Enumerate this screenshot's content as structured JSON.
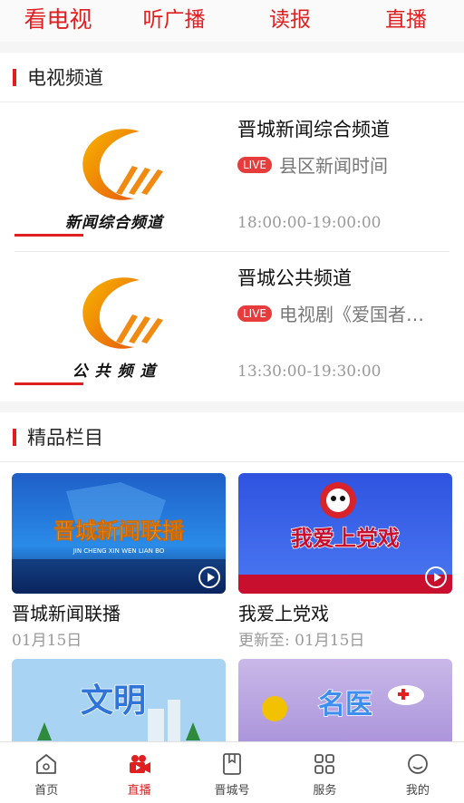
{
  "top_tabs": [
    {
      "label": "看电视"
    },
    {
      "label": "听广播"
    },
    {
      "label": "读报"
    },
    {
      "label": "直播"
    }
  ],
  "tv_section": {
    "title": "电视频道",
    "channels": [
      {
        "logo_text": "新闻综合频道",
        "name": "晋城新闻综合频道",
        "live_badge": "LIVE",
        "program": "县区新闻时间",
        "time": "18:00:00-19:00:00"
      },
      {
        "logo_text": "公 共 频 道",
        "name": "晋城公共频道",
        "live_badge": "LIVE",
        "program": "电视剧《爱国者…",
        "time": "13:30:00-19:30:00"
      }
    ]
  },
  "featured_section": {
    "title": "精品栏目",
    "items": [
      {
        "title": "晋城新闻联播",
        "date": "01月15日",
        "thumb_text": "晋城新闻联播",
        "thumb_sub": "JIN CHENG XIN WEN LIAN BO"
      },
      {
        "title": "我爱上党戏",
        "date": "更新至:  01月15日",
        "thumb_text": "我爱上党戏"
      },
      {
        "title": "",
        "date": "",
        "thumb_text": "文明"
      },
      {
        "title": "",
        "date": "",
        "thumb_text": "名医"
      }
    ]
  },
  "bottom_nav": [
    {
      "label": "首页",
      "icon": "home-icon"
    },
    {
      "label": "直播",
      "icon": "camera-icon"
    },
    {
      "label": "晋城号",
      "icon": "bookmark-icon"
    },
    {
      "label": "服务",
      "icon": "grid-icon"
    },
    {
      "label": "我的",
      "icon": "profile-icon"
    }
  ],
  "colors": {
    "accent": "#e02020",
    "live": "#e63c3c"
  }
}
